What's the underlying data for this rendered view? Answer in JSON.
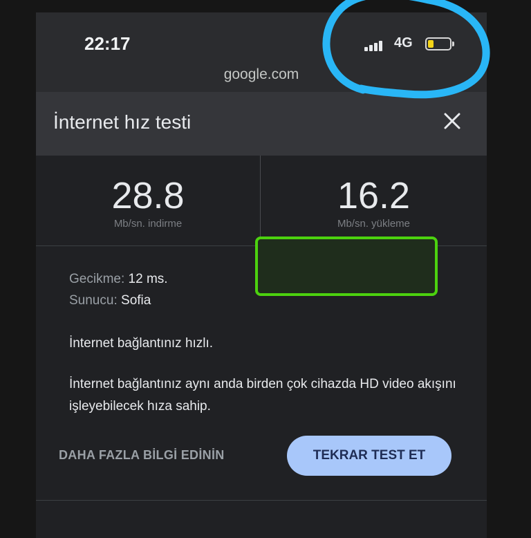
{
  "status_bar": {
    "time": "22:17",
    "network": "4G",
    "url": "google.com",
    "battery_color": "#f4d418"
  },
  "card": {
    "title": "İnternet hız testi",
    "close_icon": "close-icon"
  },
  "download": {
    "value": "28.8",
    "unit": "Mb/sn. indirme"
  },
  "upload": {
    "value": "16.2",
    "unit": "Mb/sn. yükleme"
  },
  "details": {
    "latency_label": "Gecikme:",
    "latency_value": "12 ms.",
    "server_label": "Sunucu:",
    "server_value": "Sofia"
  },
  "status": {
    "headline": "İnternet bağlantınız hızlı.",
    "description": "İnternet bağlantınız aynı anda birden çok cihazda HD video akışını işleyebilecek hıza sahip."
  },
  "actions": {
    "learn_more": "DAHA FAZLA BİLGİ EDİNİN",
    "retest": "TEKRAR TEST ET"
  },
  "colors": {
    "annotation_circle": "#29b6f6",
    "redaction_border": "#4cd20f",
    "retest_button": "#a8c7fa"
  }
}
